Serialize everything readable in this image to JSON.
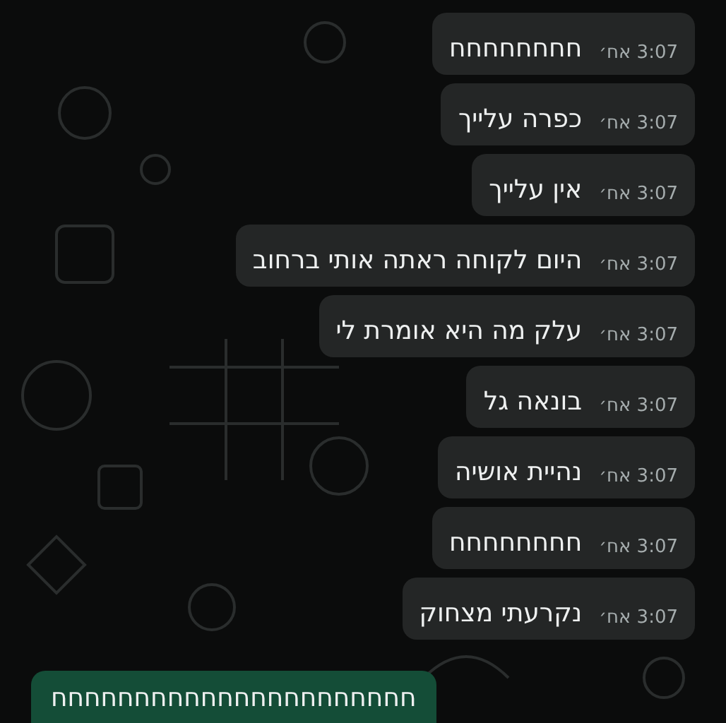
{
  "messages": [
    {
      "kind": "incoming",
      "text": "חחחחחחחח",
      "time": "3:07 אח׳"
    },
    {
      "kind": "incoming",
      "text": "כפרה עלייך",
      "time": "3:07 אח׳"
    },
    {
      "kind": "incoming",
      "text": "אין עלייך",
      "time": "3:07 אח׳"
    },
    {
      "kind": "incoming",
      "text": "היום לקוחה ראתה אותי ברחוב",
      "time": "3:07 אח׳"
    },
    {
      "kind": "incoming",
      "text": "עלק מה היא אומרת לי",
      "time": "3:07 אח׳"
    },
    {
      "kind": "incoming",
      "text": "בונאה גל",
      "time": "3:07 אח׳"
    },
    {
      "kind": "incoming",
      "text": "נהיית אושיה",
      "time": "3:07 אח׳"
    },
    {
      "kind": "incoming",
      "text": "חחחחחחחח",
      "time": "3:07 אח׳"
    },
    {
      "kind": "incoming",
      "text": "נקרעתי מצחוק",
      "time": "3:07 אח׳"
    },
    {
      "kind": "outgoing",
      "text": "חחחחחחחחחחחחחחחחחחחחחח"
    }
  ]
}
